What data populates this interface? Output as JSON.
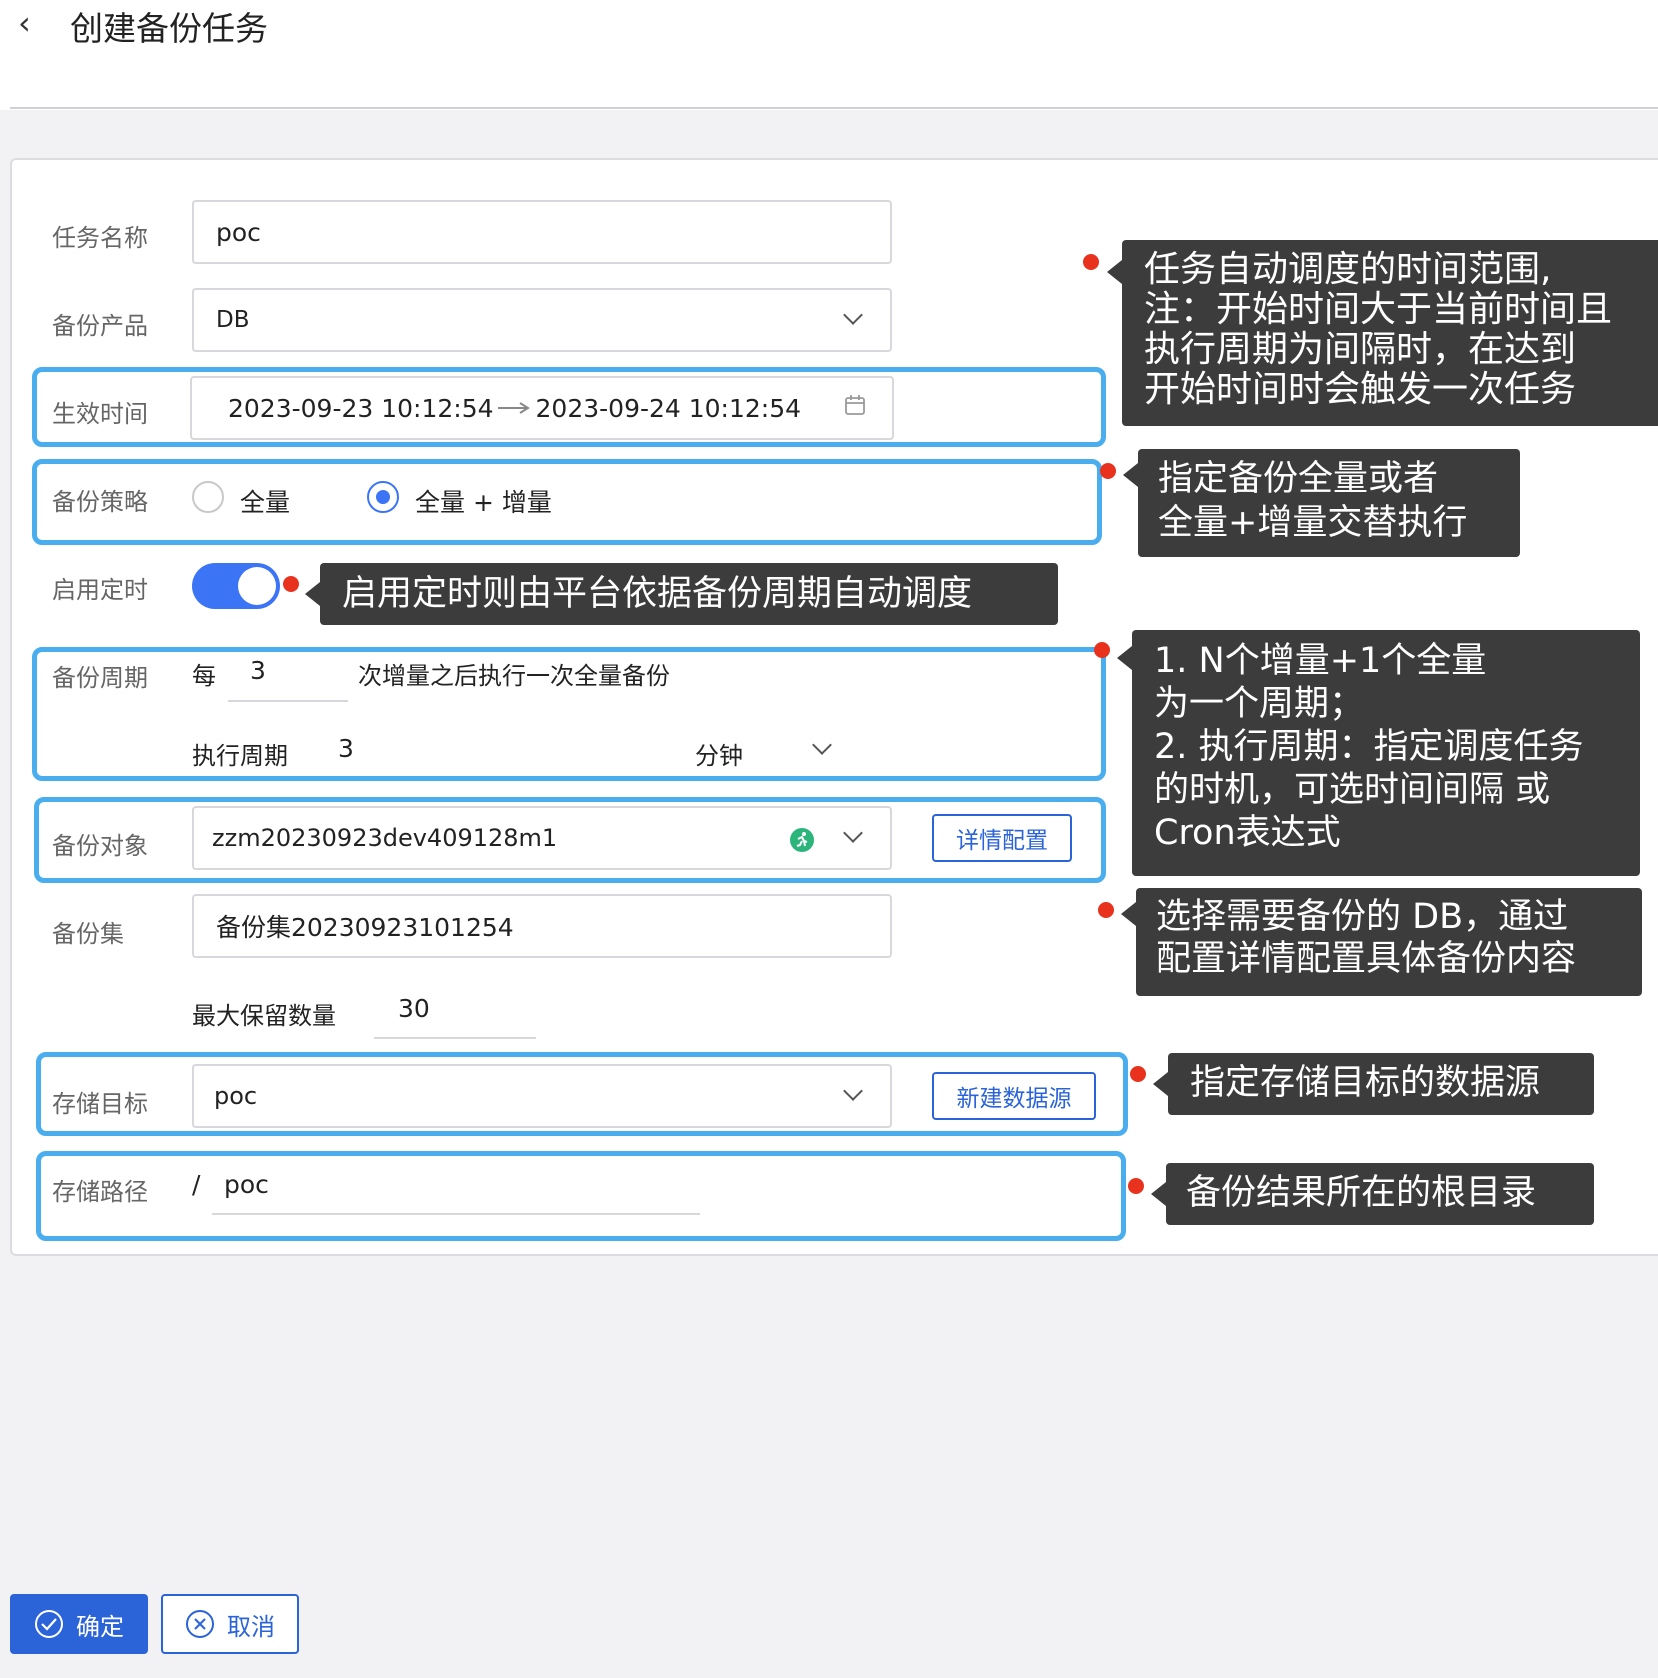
{
  "header": {
    "back_icon": "‹",
    "title": "创建备份任务"
  },
  "form": {
    "task_name": {
      "label": "任务名称",
      "value": "poc"
    },
    "product": {
      "label": "备份产品",
      "value": "DB"
    },
    "effective_time": {
      "label": "生效时间",
      "start": "2023-09-23 10:12:54",
      "end": "2023-09-24 10:12:54"
    },
    "strategy": {
      "label": "备份策略",
      "option_full": "全量",
      "option_incr": "全量 + 增量",
      "selected": "option_incr"
    },
    "schedule": {
      "label": "启用定时",
      "enabled": true
    },
    "cycle": {
      "label": "备份周期",
      "prefix": "每",
      "count": "3",
      "suffix": "次增量之后执行一次全量备份",
      "period_label": "执行周期",
      "period_value": "3",
      "unit": "分钟"
    },
    "target": {
      "label": "备份对象",
      "value": "zzm20230923dev409128m1",
      "detail_button": "详情配置"
    },
    "backup_set": {
      "label": "备份集",
      "value": "备份集20230923101254",
      "max_label": "最大保留数量",
      "max_value": "30"
    },
    "storage_target": {
      "label": "存储目标",
      "value": "poc",
      "new_button": "新建数据源"
    },
    "storage_path": {
      "label": "存储路径",
      "prefix": "/",
      "value": "poc"
    }
  },
  "notes": {
    "time": "任务自动调度的时间范围,\n注：开始时间大于当前时间且\n执行周期为间隔时，在达到\n开始时间时会触发一次任务",
    "strategy": "指定备份全量或者\n全量+增量交替执行",
    "schedule": "启用定时则由平台依据备份周期自动调度",
    "cycle": "1. N个增量+1个全量\n为一个周期；\n2. 执行周期：指定调度任务\n的时机，可选时间间隔 或\nCron表达式",
    "target": "选择需要备份的 DB，通过\n配置详情配置具体备份内容",
    "storage": "指定存储目标的数据源",
    "path": "备份结果所在的根目录"
  },
  "footer": {
    "confirm": "确定",
    "cancel": "取消"
  },
  "colors": {
    "primary": "#2b63d9",
    "highlight": "#4aaeee",
    "note_bg": "#3c3c3c",
    "dot": "#e8321e"
  }
}
